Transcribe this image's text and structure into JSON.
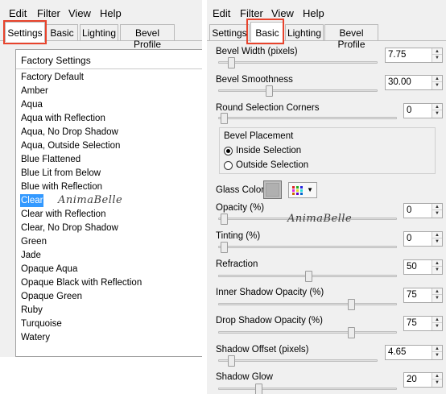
{
  "left_window": {
    "menu": [
      "Edit",
      "Filter",
      "View",
      "Help"
    ],
    "tabs": [
      "Settings",
      "Basic",
      "Lighting",
      "Bevel Profile"
    ],
    "active_tab": "Settings",
    "presets_header": "Factory Settings",
    "presets": [
      "Factory Default",
      "Amber",
      "Aqua",
      "Aqua with Reflection",
      "Aqua, No Drop Shadow",
      "Aqua, Outside Selection",
      "Blue Flattened",
      "Blue Lit from Below",
      "Blue with Reflection",
      "Clear",
      "Clear with Reflection",
      "Clear, No Drop Shadow",
      "Green",
      "Jade",
      "Opaque Aqua",
      "Opaque Black with Reflection",
      "Opaque Green",
      "Ruby",
      "Turquoise",
      "Watery"
    ],
    "selected_preset": "Clear",
    "watermark": "AnimaBelle"
  },
  "right_window": {
    "menu": [
      "Edit",
      "Filter",
      "View",
      "Help"
    ],
    "tabs": [
      "Settings",
      "Basic",
      "Lighting",
      "Bevel Profile"
    ],
    "active_tab": "Basic",
    "watermark": "AnimaBelle",
    "bevel_width": {
      "label": "Bevel Width (pixels)",
      "value": "7.75"
    },
    "bevel_smoothness": {
      "label": "Bevel Smoothness",
      "value": "30.00"
    },
    "round_corners": {
      "label": "Round Selection Corners",
      "value": "0"
    },
    "bevel_placement": {
      "label": "Bevel Placement",
      "options": [
        "Inside Selection",
        "Outside Selection"
      ],
      "selected": "Inside Selection"
    },
    "glass_color": {
      "label": "Glass Color",
      "swatch": "#b0b0b0"
    },
    "opacity": {
      "label": "Opacity (%)",
      "value": "0"
    },
    "tinting": {
      "label": "Tinting (%)",
      "value": "0"
    },
    "refraction": {
      "label": "Refraction",
      "value": "50"
    },
    "inner_shadow": {
      "label": "Inner Shadow Opacity (%)",
      "value": "75"
    },
    "drop_shadow": {
      "label": "Drop Shadow Opacity (%)",
      "value": "75"
    },
    "shadow_offset": {
      "label": "Shadow Offset (pixels)",
      "value": "4.65"
    },
    "shadow_glow": {
      "label": "Shadow Glow",
      "value": "20"
    }
  },
  "colors": {
    "highlight": "#e8432c",
    "selection": "#3399ff"
  }
}
